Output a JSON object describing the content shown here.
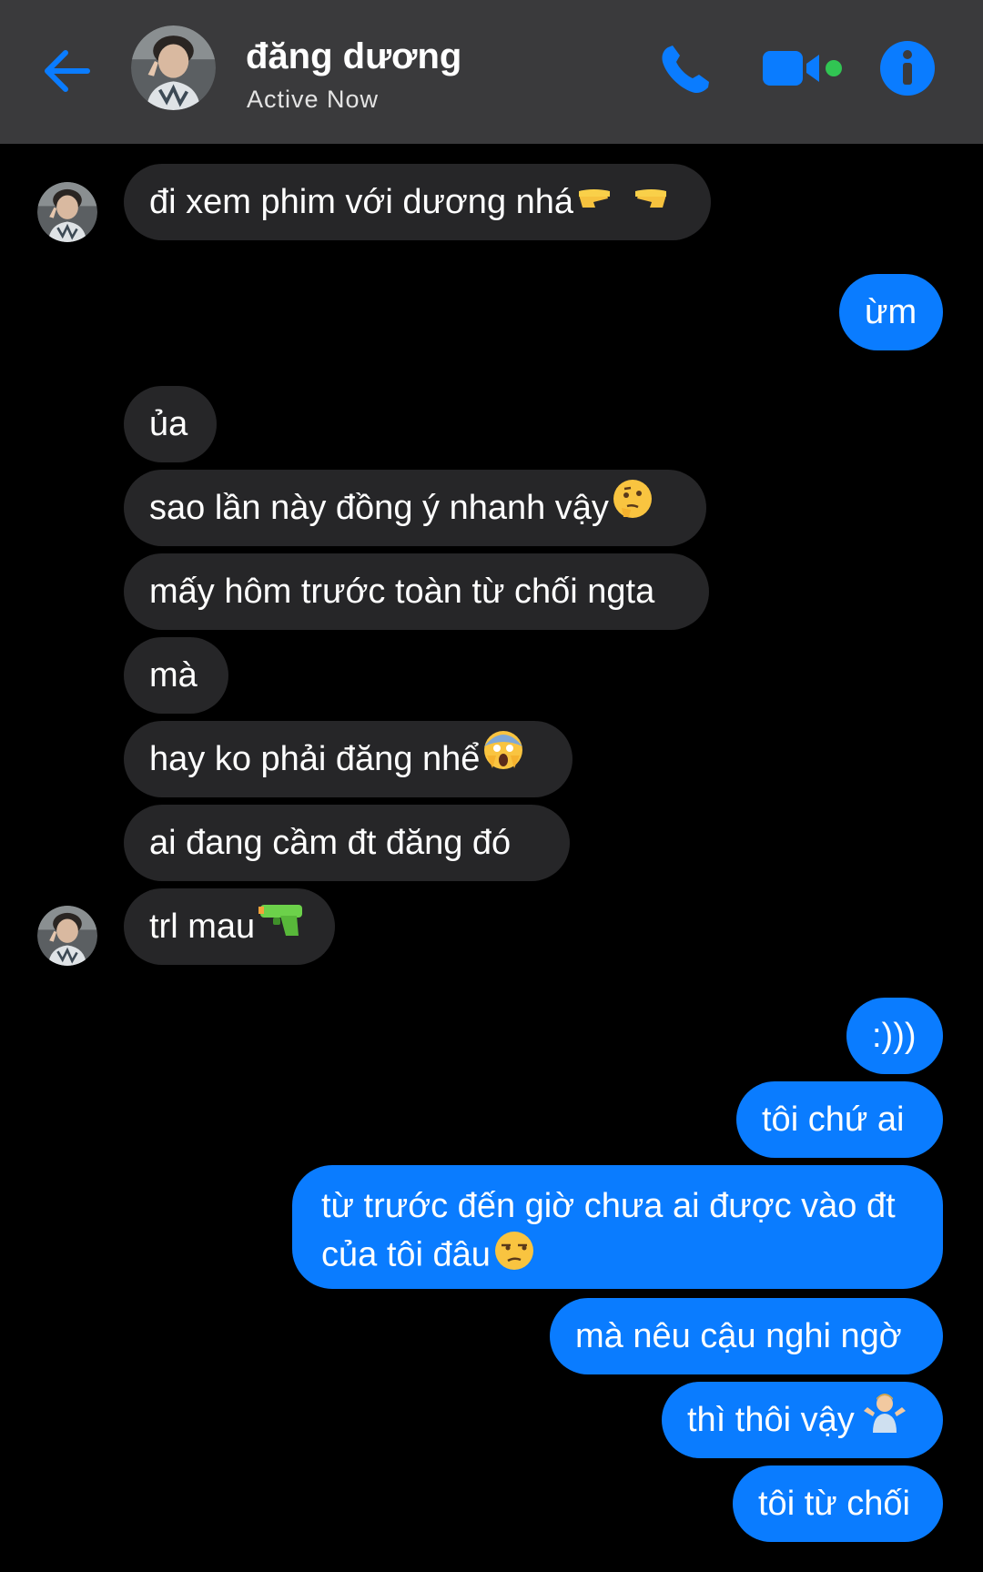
{
  "header": {
    "contact_name": "đăng dương",
    "status": "Active Now"
  },
  "colors": {
    "accent": "#0a7cff",
    "header_bg": "#3a3a3c",
    "incoming_bg": "#262628",
    "active_dot": "#31c553"
  },
  "messages": [
    {
      "side": "in",
      "text": "đi xem phim với dương nhá",
      "emoji": "backhand-index-pointing-right-and-left"
    },
    {
      "side": "out",
      "text": "ừm"
    },
    {
      "side": "in",
      "text": "ủa"
    },
    {
      "side": "in",
      "text": "sao lần này đồng ý nhanh vậy",
      "emoji": "thinking-face"
    },
    {
      "side": "in",
      "text": "mấy hôm trước toàn từ chối ngta"
    },
    {
      "side": "in",
      "text": "mà"
    },
    {
      "side": "in",
      "text": "hay ko phải đăng nhể",
      "emoji": "face-screaming-in-fear"
    },
    {
      "side": "in",
      "text": "ai đang cầm đt đăng đó"
    },
    {
      "side": "in",
      "text": "trl mau",
      "emoji": "water-pistol"
    },
    {
      "side": "out",
      "text": ":)))"
    },
    {
      "side": "out",
      "text": "tôi chứ ai"
    },
    {
      "side": "out",
      "text_line1": "từ trước đến giờ chưa ai được vào đt",
      "text_line2": "của tôi đâu",
      "emoji": "unamused-face"
    },
    {
      "side": "out",
      "text": "mà nêu cậu nghi ngờ"
    },
    {
      "side": "out",
      "text": "thì thôi vậy",
      "emoji": "person-shrugging"
    },
    {
      "side": "out",
      "text": "tôi từ chối"
    }
  ]
}
